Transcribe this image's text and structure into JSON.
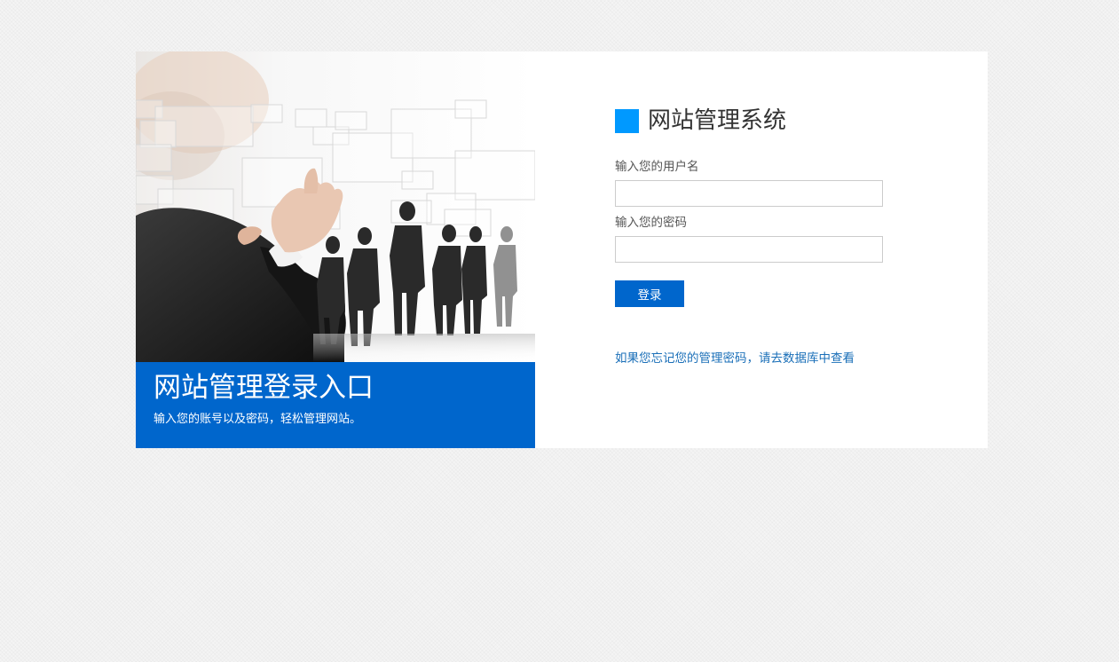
{
  "hero": {
    "title": "网站管理登录入口",
    "subtitle": "输入您的账号以及密码，轻松管理网站。",
    "image_icon": "business-people-touchscreen-illustration"
  },
  "form": {
    "brand_title": "网站管理系统",
    "username_label": "输入您的用户名",
    "username_value": "",
    "password_label": "输入您的密码",
    "password_value": "",
    "login_label": "登录",
    "forgot_text": "如果您忘记您的管理密码，请去数据库中查看"
  },
  "colors": {
    "banner": "#0066cc",
    "brand_mark": "#0099ff",
    "button": "#0066cc",
    "link": "#1a6fb8"
  }
}
